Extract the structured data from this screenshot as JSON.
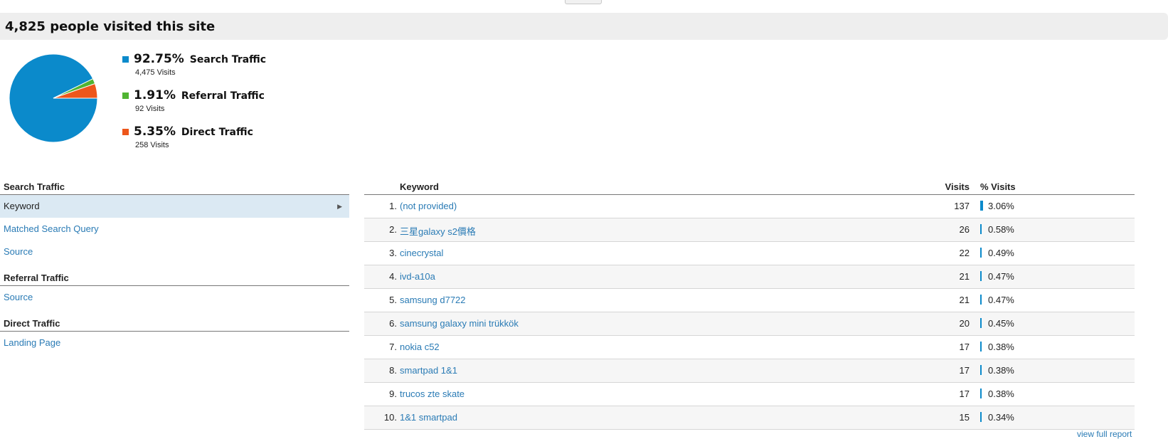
{
  "header": {
    "title": "4,825 people visited this site"
  },
  "chart_data": {
    "type": "pie",
    "slices": [
      {
        "name": "Search Traffic",
        "percent": 92.75,
        "visits": 4475,
        "color": "#0b8acb"
      },
      {
        "name": "Referral Traffic",
        "percent": 1.91,
        "visits": 92,
        "color": "#50b432"
      },
      {
        "name": "Direct Traffic",
        "percent": 5.35,
        "visits": 258,
        "color": "#ed561b"
      }
    ]
  },
  "legend": [
    {
      "pct": "92.75%",
      "name": "Search Traffic",
      "visits": "4,475 Visits",
      "color": "#0b8acb"
    },
    {
      "pct": "1.91%",
      "name": "Referral Traffic",
      "visits": "92 Visits",
      "color": "#50b432"
    },
    {
      "pct": "5.35%",
      "name": "Direct Traffic",
      "visits": "258 Visits",
      "color": "#ed561b"
    }
  ],
  "sidebar": {
    "search_heading": "Search Traffic",
    "keyword": "Keyword",
    "matched_query": "Matched Search Query",
    "search_source": "Source",
    "referral_heading": "Referral Traffic",
    "referral_source": "Source",
    "direct_heading": "Direct Traffic",
    "landing_page": "Landing Page"
  },
  "table": {
    "headers": {
      "keyword": "Keyword",
      "visits": "Visits",
      "pct_visits": "% Visits"
    },
    "rows": [
      {
        "num": "1.",
        "keyword": "(not provided)",
        "visits": "137",
        "pct": "3.06%",
        "frac": 0.0306
      },
      {
        "num": "2.",
        "keyword": "三星galaxy s2價格",
        "visits": "26",
        "pct": "0.58%",
        "frac": 0.0058
      },
      {
        "num": "3.",
        "keyword": "cinecrystal",
        "visits": "22",
        "pct": "0.49%",
        "frac": 0.0049
      },
      {
        "num": "4.",
        "keyword": "ivd-a10a",
        "visits": "21",
        "pct": "0.47%",
        "frac": 0.0047
      },
      {
        "num": "5.",
        "keyword": "samsung d7722",
        "visits": "21",
        "pct": "0.47%",
        "frac": 0.0047
      },
      {
        "num": "6.",
        "keyword": "samsung galaxy mini trükkök",
        "visits": "20",
        "pct": "0.45%",
        "frac": 0.0045
      },
      {
        "num": "7.",
        "keyword": "nokia c52",
        "visits": "17",
        "pct": "0.38%",
        "frac": 0.0038
      },
      {
        "num": "8.",
        "keyword": "smartpad 1&1",
        "visits": "17",
        "pct": "0.38%",
        "frac": 0.0038
      },
      {
        "num": "9.",
        "keyword": "trucos zte skate",
        "visits": "17",
        "pct": "0.38%",
        "frac": 0.0038
      },
      {
        "num": "10.",
        "keyword": "1&1 smartpad",
        "visits": "15",
        "pct": "0.34%",
        "frac": 0.0034
      }
    ]
  },
  "footer": {
    "view_full_report": "view full report"
  }
}
